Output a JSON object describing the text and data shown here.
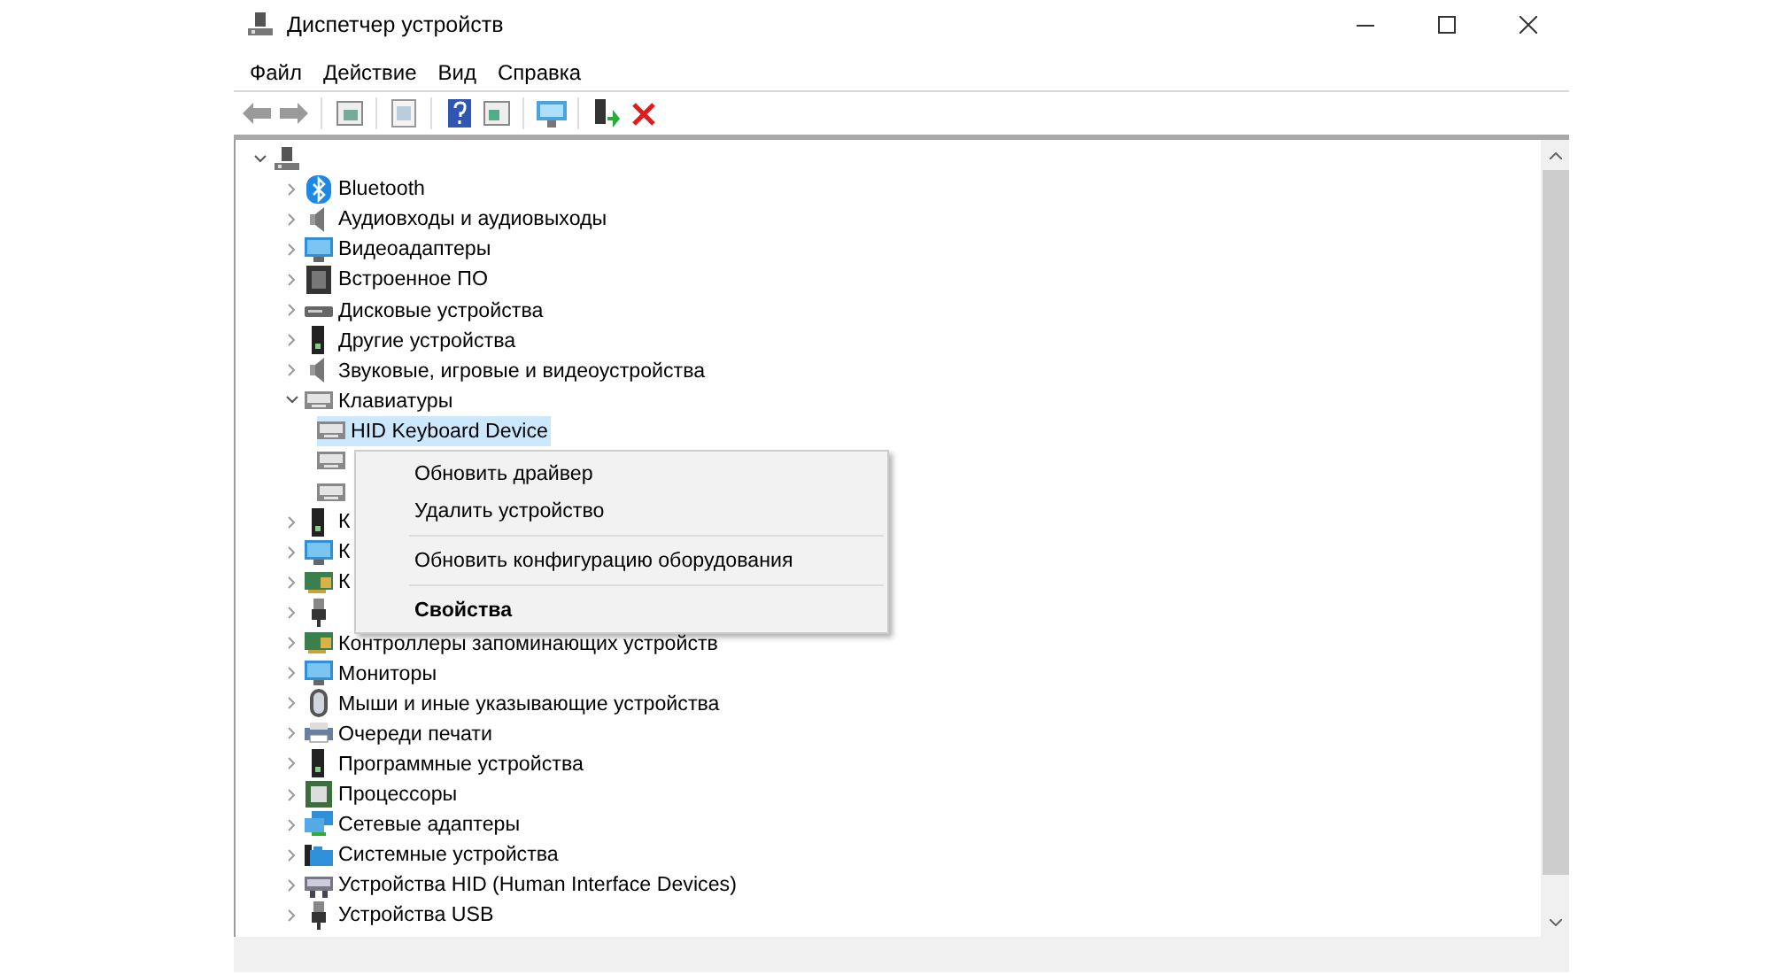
{
  "window": {
    "title": "Диспетчер устройств"
  },
  "menu_bar": [
    "Файл",
    "Действие",
    "Вид",
    "Справка"
  ],
  "tree": {
    "root": {
      "expanded": true,
      "selected": false,
      "children": [
        {
          "label": "Bluetooth",
          "expanded": false,
          "selected": false
        },
        {
          "label": "Аудиовходы и аудиовыходы",
          "expanded": false,
          "selected": false
        },
        {
          "label": "Видеоадаптеры",
          "expanded": false,
          "selected": false
        },
        {
          "label": "Встроенное ПО",
          "expanded": false,
          "selected": false
        },
        {
          "label": "Дисковые устройства",
          "expanded": false,
          "selected": false
        },
        {
          "label": "Другие устройства",
          "expanded": false,
          "selected": false
        },
        {
          "label": "Звуковые, игровые и видеоустройства",
          "expanded": false,
          "selected": false
        },
        {
          "label": "Клавиатуры",
          "expanded": true,
          "selected": false,
          "children": [
            {
              "label": "HID Keyboard Device",
              "selected": true
            },
            {
              "selected": false
            },
            {
              "selected": false
            }
          ]
        },
        {
          "label": "К",
          "expanded": false,
          "selected": false
        },
        {
          "label": "К",
          "expanded": false,
          "selected": false
        },
        {
          "label": "К",
          "expanded": false,
          "selected": false
        },
        {
          "expanded": false,
          "selected": false
        },
        {
          "label": "Контроллеры запоминающих устройств",
          "expanded": false,
          "selected": false
        },
        {
          "label": "Мониторы",
          "expanded": false,
          "selected": false
        },
        {
          "label": "Мыши и иные указывающие устройства",
          "expanded": false,
          "selected": false
        },
        {
          "label": "Очереди печати",
          "expanded": false,
          "selected": false
        },
        {
          "label": "Программные устройства",
          "expanded": false,
          "selected": false
        },
        {
          "label": "Процессоры",
          "expanded": false,
          "selected": false
        },
        {
          "label": "Сетевые адаптеры",
          "expanded": false,
          "selected": false
        },
        {
          "label": "Системные устройства",
          "expanded": false,
          "selected": false
        },
        {
          "label": "Устройства HID (Human Interface Devices)",
          "expanded": false,
          "selected": false
        },
        {
          "label": "Устройства USB",
          "expanded": false,
          "selected": false
        }
      ]
    }
  },
  "context_menu": {
    "items": [
      {
        "kind": "item",
        "label": "Обновить драйвер",
        "default": false
      },
      {
        "kind": "item",
        "label": "Удалить устройство",
        "default": false
      },
      {
        "kind": "separator"
      },
      {
        "kind": "item",
        "label": "Обновить конфигурацию оборудования",
        "default": false
      },
      {
        "kind": "separator"
      },
      {
        "kind": "item",
        "label": "Свойства",
        "default": true
      }
    ]
  }
}
